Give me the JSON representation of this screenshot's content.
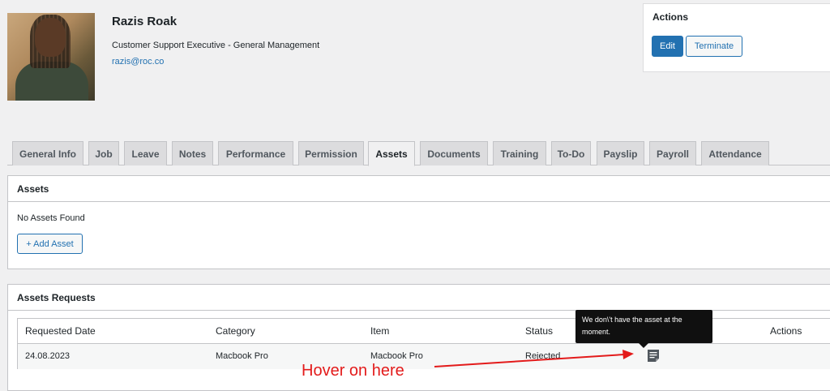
{
  "profile": {
    "name": "Razis Roak",
    "title": "Customer Support Executive - General Management",
    "email": "razis@roc.co"
  },
  "actions": {
    "heading": "Actions",
    "edit_label": "Edit",
    "terminate_label": "Terminate"
  },
  "tabs": [
    {
      "label": "General Info"
    },
    {
      "label": "Job"
    },
    {
      "label": "Leave"
    },
    {
      "label": "Notes"
    },
    {
      "label": "Performance"
    },
    {
      "label": "Permission"
    },
    {
      "label": "Assets",
      "active": true
    },
    {
      "label": "Documents"
    },
    {
      "label": "Training"
    },
    {
      "label": "To-Do"
    },
    {
      "label": "Payslip"
    },
    {
      "label": "Payroll"
    },
    {
      "label": "Attendance"
    }
  ],
  "assets_panel": {
    "heading": "Assets",
    "empty_text": "No Assets Found",
    "add_label": "+ Add Asset"
  },
  "requests_panel": {
    "heading": "Assets Requests",
    "columns": [
      "Requested Date",
      "Category",
      "Item",
      "Status",
      "Actions"
    ],
    "rows": [
      {
        "date": "24.08.2023",
        "category": "Macbook Pro",
        "item": "Macbook Pro",
        "status": "Rejected",
        "note_icon": "notes-icon"
      }
    ]
  },
  "tooltip": {
    "text": "We don\\'t have the asset at the moment."
  },
  "annotation": {
    "text": "Hover on here",
    "color": "#e31b1b"
  },
  "colors": {
    "accent": "#2271b1",
    "background": "#f0f0f1"
  }
}
